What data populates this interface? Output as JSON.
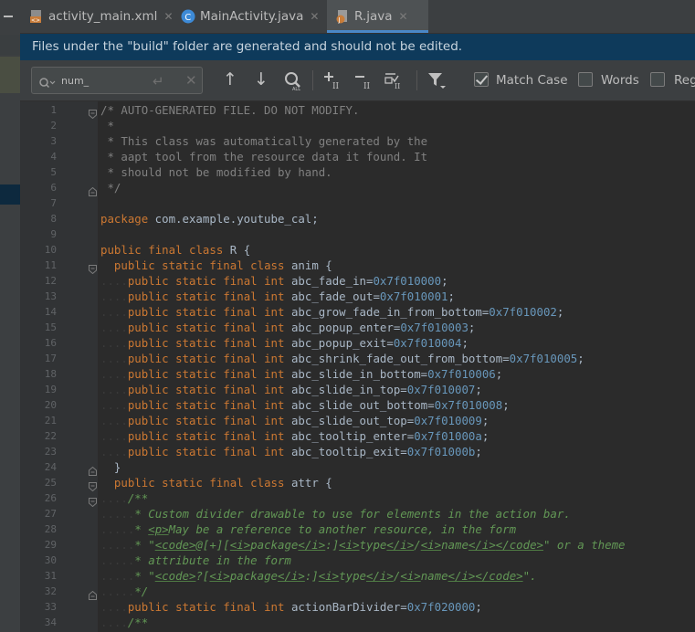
{
  "tabs": [
    {
      "label": "activity_main.xml",
      "icon": "xml-file-icon",
      "active": false
    },
    {
      "label": "MainActivity.java",
      "icon": "java-class-icon",
      "active": false
    },
    {
      "label": "R.java",
      "icon": "java-file-icon",
      "active": true
    }
  ],
  "banner": {
    "text": "Files under the \"build\" folder are generated and should not be edited."
  },
  "search": {
    "value": "num_",
    "options": {
      "match_case": {
        "label": "Match Case",
        "checked": true
      },
      "words": {
        "label": "Words",
        "checked": false
      },
      "regex": {
        "label": "Reg",
        "checked": false
      }
    }
  },
  "editor": {
    "lines": [
      {
        "n": "1",
        "text": "/* AUTO-GENERATED FILE. DO NOT MODIFY."
      },
      {
        "n": "2",
        "text": " *"
      },
      {
        "n": "3",
        "text": " * This class was automatically generated by the"
      },
      {
        "n": "4",
        "text": " * aapt tool from the resource data it found. It"
      },
      {
        "n": "5",
        "text": " * should not be modified by hand."
      },
      {
        "n": "6",
        "text": " */"
      },
      {
        "n": "7",
        "text": ""
      },
      {
        "n": "8",
        "text": "package com.example.youtube_cal;"
      },
      {
        "n": "9",
        "text": ""
      },
      {
        "n": "10",
        "text": "public final class R {"
      },
      {
        "n": "11",
        "text": "  public static final class anim {"
      },
      {
        "n": "12",
        "text": "    public static final int abc_fade_in=0x7f010000;"
      },
      {
        "n": "13",
        "text": "    public static final int abc_fade_out=0x7f010001;"
      },
      {
        "n": "14",
        "text": "    public static final int abc_grow_fade_in_from_bottom=0x7f010002;"
      },
      {
        "n": "15",
        "text": "    public static final int abc_popup_enter=0x7f010003;"
      },
      {
        "n": "16",
        "text": "    public static final int abc_popup_exit=0x7f010004;"
      },
      {
        "n": "17",
        "text": "    public static final int abc_shrink_fade_out_from_bottom=0x7f010005;"
      },
      {
        "n": "18",
        "text": "    public static final int abc_slide_in_bottom=0x7f010006;"
      },
      {
        "n": "19",
        "text": "    public static final int abc_slide_in_top=0x7f010007;"
      },
      {
        "n": "20",
        "text": "    public static final int abc_slide_out_bottom=0x7f010008;"
      },
      {
        "n": "21",
        "text": "    public static final int abc_slide_out_top=0x7f010009;"
      },
      {
        "n": "22",
        "text": "    public static final int abc_tooltip_enter=0x7f01000a;"
      },
      {
        "n": "23",
        "text": "    public static final int abc_tooltip_exit=0x7f01000b;"
      },
      {
        "n": "24",
        "text": "  }"
      },
      {
        "n": "25",
        "text": "  public static final class attr {"
      },
      {
        "n": "26",
        "text": "    /**"
      },
      {
        "n": "27",
        "text": "     * Custom divider drawable to use for elements in the action bar."
      },
      {
        "n": "28",
        "text": "     * <p>May be a reference to another resource, in the form"
      },
      {
        "n": "29",
        "text": "     * \"<code>@[+][<i>package</i>:]<i>type</i>/<i>name</i></code>\" or a theme"
      },
      {
        "n": "30",
        "text": "     * attribute in the form"
      },
      {
        "n": "31",
        "text": "     * \"<code>?[<i>package</i>:]<i>type</i>/<i>name</i></code>\"."
      },
      {
        "n": "32",
        "text": "     */"
      },
      {
        "n": "33",
        "text": "    public static final int actionBarDivider=0x7f020000;"
      },
      {
        "n": "34",
        "text": "    /**"
      }
    ]
  },
  "colors": {
    "keyword": "#cc7832",
    "number": "#6897bb",
    "comment": "#808080",
    "doc_comment": "#629755",
    "identifier": "#a9b7c6",
    "banner_bg": "#0e3a5b",
    "tab_underline": "#4a88c7"
  }
}
